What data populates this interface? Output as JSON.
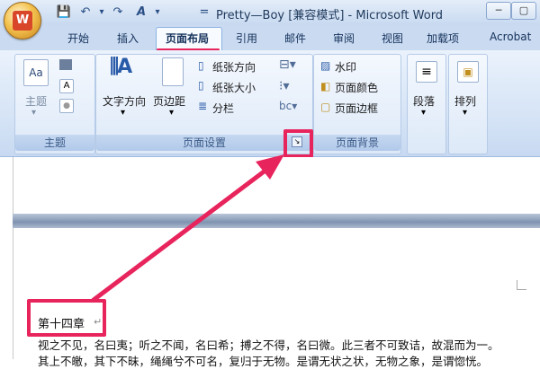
{
  "window": {
    "title": "Pretty—Boy [兼容模式] - Microsoft Word",
    "min": "─",
    "max": "▢",
    "office_logo": "W"
  },
  "quick_access": [
    "💾",
    "↶",
    "▾",
    "↷",
    "A",
    "▾",
    "="
  ],
  "tabs": [
    "开始",
    "插入",
    "页面布局",
    "引用",
    "邮件",
    "审阅",
    "视图",
    "加载项",
    "Acrobat"
  ],
  "ribbon": {
    "theme_group": {
      "label": "主题",
      "theme_button": "主题"
    },
    "page_setup": {
      "label": "页面设置",
      "text_direction": "文字方向",
      "margins": "页边距",
      "orientation": "纸张方向",
      "size": "纸张大小",
      "columns": "分栏"
    },
    "page_background": {
      "label": "页面背景",
      "watermark": "水印",
      "page_color": "页面颜色",
      "page_borders": "页面边框"
    },
    "paragraph": "段落",
    "arrange": "排列"
  },
  "document": {
    "heading": "第十四章",
    "line1": "视之不见，名曰夷；听之不闻，名曰希；搏之不得，名曰微。此三者不可致诘，故混而为一。",
    "line2": "其上不皦，其下不昧，绳绳兮不可名，复归于无物。是谓无状之状，无物之象，是谓惚恍。"
  },
  "colors": {
    "highlight": "#e8245d",
    "ribbon": "#d3e2f5",
    "tab_bar": "#c9daf1"
  }
}
